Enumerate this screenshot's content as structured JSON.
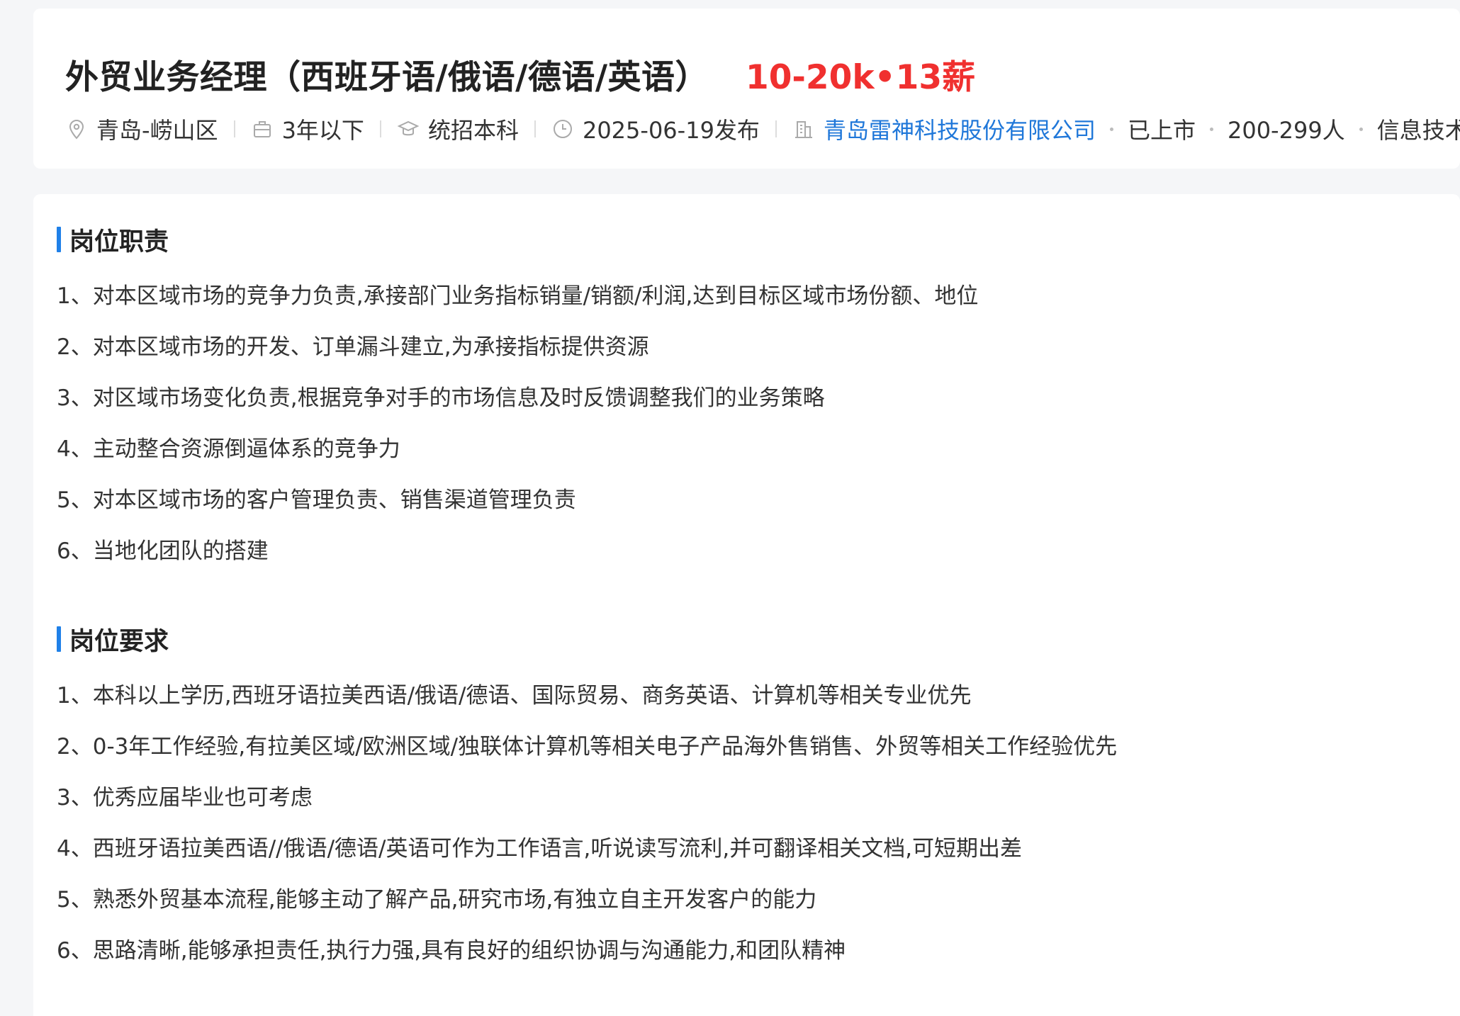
{
  "job": {
    "title": "外贸业务经理（西班牙语/俄语/德语/英语）",
    "salary": "10-20k•13薪"
  },
  "meta": {
    "location": "青岛-崂山区",
    "experience": "3年以下",
    "education": "统招本科",
    "published": "2025-06-19发布",
    "company_name": "青岛雷神科技股份有限公司",
    "listing_status": "已上市",
    "company_size": "200-299人",
    "industry": "信息技术"
  },
  "responsibilities": {
    "title": "岗位职责",
    "items": [
      "1、对本区域市场的竞争力负责,承接部门业务指标销量/销额/利润,达到目标区域市场份额、地位",
      "2、对本区域市场的开发、订单漏斗建立,为承接指标提供资源",
      "3、对区域市场变化负责,根据竞争对手的市场信息及时反馈调整我们的业务策略",
      "4、主动整合资源倒逼体系的竞争力",
      "5、对本区域市场的客户管理负责、销售渠道管理负责",
      "6、当地化团队的搭建"
    ]
  },
  "requirements": {
    "title": "岗位要求",
    "items": [
      "1、本科以上学历,西班牙语拉美西语/俄语/德语、国际贸易、商务英语、计算机等相关专业优先",
      "2、0-3年工作经验,有拉美区域/欧洲区域/独联体计算机等相关电子产品海外售销售、外贸等相关工作经验优先",
      "3、优秀应届毕业也可考虑",
      "4、西班牙语拉美西语//俄语/德语/英语可作为工作语言,听说读写流利,并可翻译相关文档,可短期出差",
      "5、熟悉外贸基本流程,能够主动了解产品,研究市场,有独立自主开发客户的能力",
      "6、思路清晰,能够承担责任,执行力强,具有良好的组织协调与沟通能力,和团队精神"
    ]
  },
  "icons": {
    "location": "location-pin-icon",
    "experience": "briefcase-icon",
    "education": "graduation-cap-icon",
    "published": "clock-icon",
    "company": "building-icon"
  },
  "colors": {
    "salary": "#f0302f",
    "company_link": "#1f77d9",
    "section_accent": "#1f80e8"
  }
}
